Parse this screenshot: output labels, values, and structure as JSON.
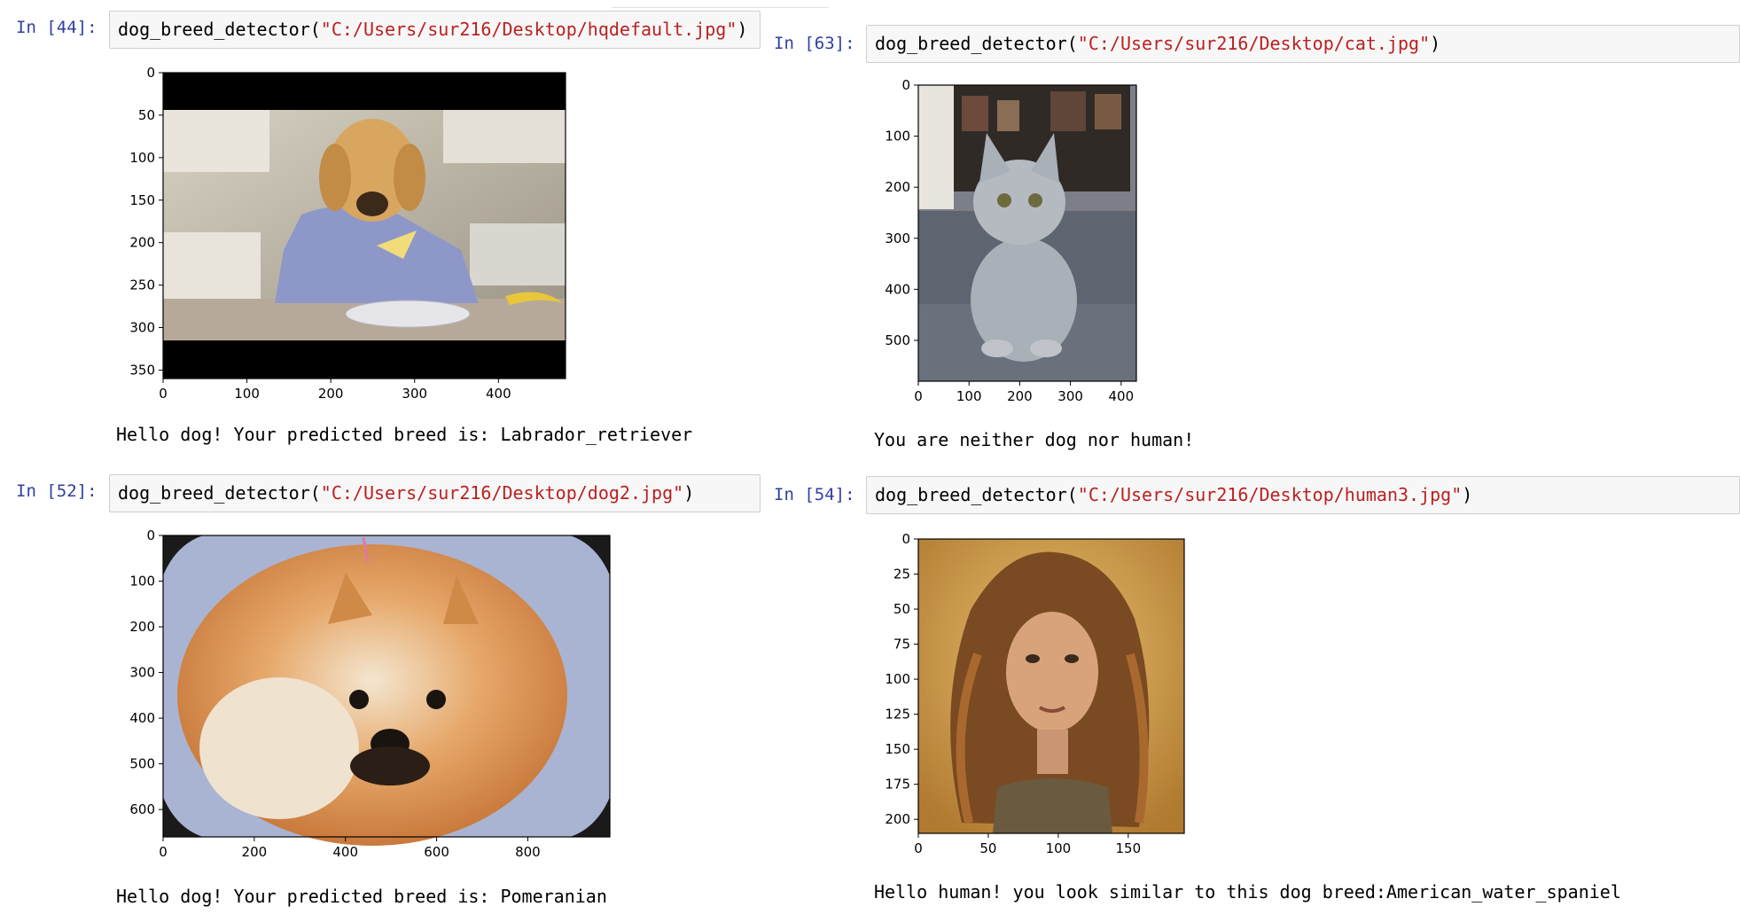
{
  "cells": [
    {
      "prompt": "In [44]:",
      "code_fn": "dog_breed_detector(",
      "code_arg": "\"C:/Users/sur216/Desktop/hqdefault.jpg\"",
      "code_end": ")",
      "output": "Hello dog! Your predicted breed is: Labrador_retriever",
      "image_subject": "golden dog wearing a sweater eating at a kitchen table",
      "x_ticks": [
        "0",
        "100",
        "200",
        "300",
        "400"
      ],
      "y_ticks": [
        "0",
        "50",
        "100",
        "150",
        "200",
        "250",
        "300",
        "350"
      ]
    },
    {
      "prompt": "In [63]:",
      "code_fn": "dog_breed_detector(",
      "code_arg": "\"C:/Users/sur216/Desktop/cat.jpg\"",
      "code_end": ")",
      "output": "You are neither dog nor human!",
      "image_subject": "grey kitten sitting on a couch",
      "x_ticks": [
        "0",
        "100",
        "200",
        "300",
        "400"
      ],
      "y_ticks": [
        "0",
        "100",
        "200",
        "300",
        "400",
        "500"
      ]
    },
    {
      "prompt": "In [52]:",
      "code_fn": "dog_breed_detector(",
      "code_arg": "\"C:/Users/sur216/Desktop/dog2.jpg\"",
      "code_end": ")",
      "output": "Hello dog! Your predicted breed is: Pomeranian",
      "image_subject": "fluffy orange pomeranian dog",
      "x_ticks": [
        "0",
        "200",
        "400",
        "600",
        "800"
      ],
      "y_ticks": [
        "0",
        "100",
        "200",
        "300",
        "400",
        "500",
        "600"
      ]
    },
    {
      "prompt": "In [54]:",
      "code_fn": "dog_breed_detector(",
      "code_arg": "\"C:/Users/sur216/Desktop/human3.jpg\"",
      "code_end": ")",
      "output": "Hello human! you look similar to this dog breed:American_water_spaniel",
      "image_subject": "portrait of a woman with long curly red hair",
      "x_ticks": [
        "0",
        "50",
        "100",
        "150"
      ],
      "y_ticks": [
        "0",
        "25",
        "50",
        "75",
        "100",
        "125",
        "150",
        "175",
        "200"
      ]
    }
  ],
  "colors": {
    "prompt": "#303f9f",
    "string": "#ba2121",
    "input_bg": "#f7f7f7",
    "input_border": "#cfcfcf"
  }
}
